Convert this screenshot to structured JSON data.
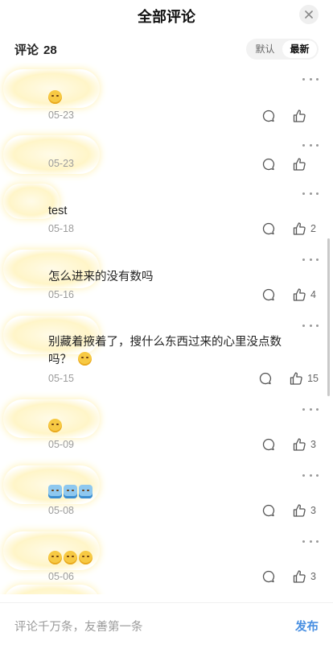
{
  "header": {
    "title": "全部评论"
  },
  "subheader": {
    "label": "评论",
    "count": "28",
    "sort_default": "默认",
    "sort_latest": "最新"
  },
  "comments": [
    {
      "text": "",
      "date": "05-23",
      "likes": "",
      "emojis": [
        "smirk"
      ]
    },
    {
      "text": "",
      "date": "05-23",
      "likes": "",
      "emojis": []
    },
    {
      "text": "test",
      "date": "05-18",
      "likes": "2",
      "emojis": []
    },
    {
      "text": "怎么进来的没有数吗",
      "date": "05-16",
      "likes": "4",
      "emojis": []
    },
    {
      "text": "别藏着掖着了，搜什么东西过来的心里没点数吗？",
      "date": "05-15",
      "likes": "15",
      "emojis": [
        "smirk"
      ]
    },
    {
      "text": "",
      "date": "05-09",
      "likes": "3",
      "emojis": [
        "tongue"
      ]
    },
    {
      "text": "",
      "date": "05-08",
      "likes": "3",
      "emojis": [
        "sticker",
        "sticker",
        "sticker"
      ]
    },
    {
      "text": "",
      "date": "05-06",
      "likes": "3",
      "emojis": [
        "smirk",
        "smirk",
        "grin"
      ]
    }
  ],
  "footer": {
    "placeholder": "评论千万条，友善第一条",
    "send": "发布"
  },
  "colors": {
    "accent": "#4a90e2",
    "text_muted": "#9b9b9b"
  }
}
